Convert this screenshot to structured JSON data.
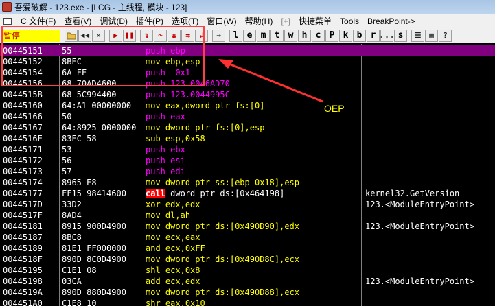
{
  "window": {
    "title": "吾爱破解 - 123.exe - [LCG - 主线程, 模块 - 123]"
  },
  "menu": [
    {
      "label": "C 文件(F)"
    },
    {
      "label": "查看(V)"
    },
    {
      "label": "调试(D)"
    },
    {
      "label": "插件(P)"
    },
    {
      "label": "选项(T)"
    },
    {
      "label": "窗口(W)"
    },
    {
      "label": "帮助(H)"
    },
    {
      "label": "[+]"
    },
    {
      "label": "快捷菜单"
    },
    {
      "label": "Tools"
    },
    {
      "label": "BreakPoint->"
    }
  ],
  "toolbar": {
    "status": "暂停",
    "letters": [
      "l",
      "e",
      "m",
      "t",
      "w",
      "h",
      "c",
      "P",
      "k",
      "b",
      "r",
      "...",
      "s"
    ]
  },
  "disasm": [
    {
      "addr": "00445151",
      "hex": "55",
      "mn": "push",
      "op": "ebp",
      "cmt": ""
    },
    {
      "addr": "00445152",
      "hex": "8BEC",
      "mn": "mov",
      "op": "ebp,esp",
      "cmt": ""
    },
    {
      "addr": "00445154",
      "hex": "6A FF",
      "mn": "push",
      "op": "-0x1",
      "cmt": ""
    },
    {
      "addr": "00445156",
      "hex": "68 70AD4600",
      "mn": "push",
      "op": "123.0046AD70",
      "cmt": ""
    },
    {
      "addr": "0044515B",
      "hex": "68 5C994400",
      "mn": "push",
      "op": "123.0044995C",
      "cmt": ""
    },
    {
      "addr": "00445160",
      "hex": "64:A1 00000000",
      "mn": "mov",
      "op": "eax,dword ptr fs:[0]",
      "cmt": ""
    },
    {
      "addr": "00445166",
      "hex": "50",
      "mn": "push",
      "op": "eax",
      "cmt": ""
    },
    {
      "addr": "00445167",
      "hex": "64:8925 0000000",
      "mn": "mov",
      "op": "dword ptr fs:[0],esp",
      "cmt": ""
    },
    {
      "addr": "0044516E",
      "hex": "83EC 58",
      "mn": "sub",
      "op": "esp,0x58",
      "cmt": ""
    },
    {
      "addr": "00445171",
      "hex": "53",
      "mn": "push",
      "op": "ebx",
      "cmt": ""
    },
    {
      "addr": "00445172",
      "hex": "56",
      "mn": "push",
      "op": "esi",
      "cmt": ""
    },
    {
      "addr": "00445173",
      "hex": "57",
      "mn": "push",
      "op": "edi",
      "cmt": ""
    },
    {
      "addr": "00445174",
      "hex": "8965 E8",
      "mn": "mov",
      "op": "dword ptr ss:[ebp-0x18],esp",
      "cmt": ""
    },
    {
      "addr": "00445177",
      "hex": "FF15 98414600",
      "mn": "call",
      "op": "dword ptr ds:[0x464198]",
      "cmt": "kernel32.GetVersion"
    },
    {
      "addr": "0044517D",
      "hex": "33D2",
      "mn": "xor",
      "op": "edx,edx",
      "cmt": "123.<ModuleEntryPoint>"
    },
    {
      "addr": "0044517F",
      "hex": "8AD4",
      "mn": "mov",
      "op": "dl,ah",
      "cmt": ""
    },
    {
      "addr": "00445181",
      "hex": "8915 900D4900",
      "mn": "mov",
      "op": "dword ptr ds:[0x490D90],edx",
      "cmt": "123.<ModuleEntryPoint>"
    },
    {
      "addr": "00445187",
      "hex": "8BC8",
      "mn": "mov",
      "op": "ecx,eax",
      "cmt": ""
    },
    {
      "addr": "00445189",
      "hex": "81E1 FF000000",
      "mn": "and",
      "op": "ecx,0xFF",
      "cmt": ""
    },
    {
      "addr": "0044518F",
      "hex": "890D 8C0D4900",
      "mn": "mov",
      "op": "dword ptr ds:[0x490D8C],ecx",
      "cmt": ""
    },
    {
      "addr": "00445195",
      "hex": "C1E1 08",
      "mn": "shl",
      "op": "ecx,0x8",
      "cmt": ""
    },
    {
      "addr": "00445198",
      "hex": "03CA",
      "mn": "add",
      "op": "ecx,edx",
      "cmt": "123.<ModuleEntryPoint>"
    },
    {
      "addr": "0044519A",
      "hex": "890D 880D4900",
      "mn": "mov",
      "op": "dword ptr ds:[0x490D88],ecx",
      "cmt": ""
    },
    {
      "addr": "004451A0",
      "hex": "C1E8 10",
      "mn": "shr",
      "op": "eax,0x10",
      "cmt": ""
    }
  ],
  "annotation": {
    "label": "OEP",
    "color": "#ff4040"
  }
}
